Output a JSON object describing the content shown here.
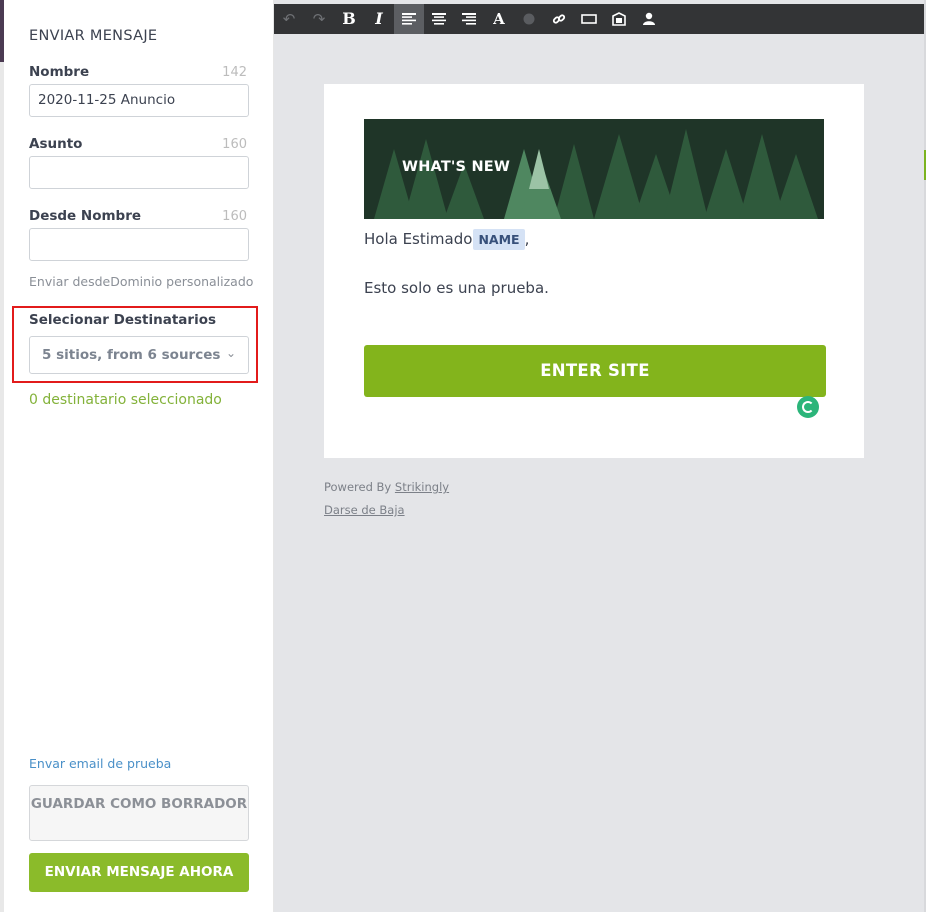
{
  "sidebar": {
    "title": "ENVIAR MENSAJE",
    "name": {
      "label": "Nombre",
      "count": "142",
      "value": "2020-11-25 Anuncio"
    },
    "subject": {
      "label": "Asunto",
      "count": "160",
      "value": ""
    },
    "from_name": {
      "label": "Desde Nombre",
      "count": "160",
      "value": ""
    },
    "send_from_hint": "Enviar desdeDominio personalizado",
    "recipients": {
      "label": "Selecionar Destinatarios",
      "selected": "5 sitios, from 6 sources",
      "count_text": "0 destinatario seleccionado"
    },
    "test_email_link": "Envar email de prueba",
    "save_draft_label": "GUARDAR COMO BORRADOR",
    "send_now_label": "ENVIAR MENSAJE AHORA"
  },
  "toolbar": {
    "icons": [
      "undo-icon",
      "redo-icon",
      "bold-icon",
      "italic-icon",
      "align-left-icon",
      "align-center-icon",
      "align-right-icon",
      "font-color-icon",
      "color-dot-icon",
      "link-icon",
      "button-icon",
      "image-icon",
      "person-icon"
    ],
    "active": "align-left-icon"
  },
  "email": {
    "hero_title": "WHAT'S NEW",
    "greeting": "Hola Estimado",
    "name_tag": "NAME",
    "greeting_suffix": ",",
    "body": "Esto solo es una prueba.",
    "cta_label": "ENTER SITE",
    "powered_prefix": "Powered By",
    "powered_link": "Strikingly",
    "unsubscribe": "Darse de Baja"
  },
  "colors": {
    "accent_green": "#83b41c",
    "highlight_red": "#e21b1b",
    "link_blue": "#4a90c8"
  }
}
